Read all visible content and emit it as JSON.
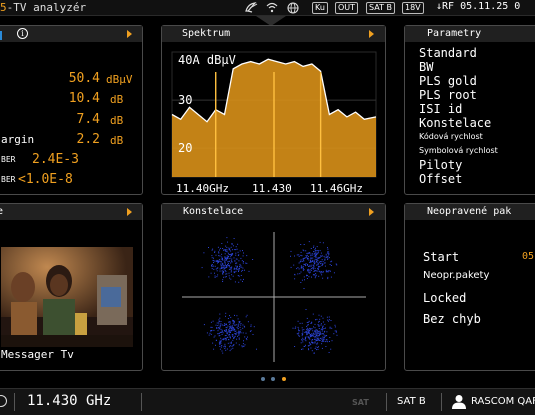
{
  "header": {
    "title_accent": "5",
    "title": "-TV analyzér",
    "badges": [
      "Ku",
      "OUT",
      "SAT B",
      "18V"
    ],
    "rf_label": "↓RF",
    "date": "05.11.25 0"
  },
  "left_panel": {
    "rows": [
      {
        "label": "",
        "value": "50.4",
        "unit": "dBµV"
      },
      {
        "label": "",
        "value": "10.4",
        "unit": "dB"
      },
      {
        "label": "",
        "value": "7.4",
        "unit": "dB"
      },
      {
        "label": "argin",
        "value": "2.2",
        "unit": "dB"
      },
      {
        "label": "BER",
        "value": "2.4E-3",
        "unit": ""
      },
      {
        "label": "BER",
        "value": "<1.0E-8",
        "unit": ""
      }
    ]
  },
  "spectrum": {
    "title": "Spektrum",
    "level": "40A dBµV",
    "y_labels": [
      "30",
      "20"
    ],
    "x_labels": [
      "11.40GHz",
      "11.430",
      "11.46GHz"
    ]
  },
  "chart_data": {
    "type": "area",
    "title": "Spektrum",
    "ylabel": "dBµV",
    "x_range": [
      11.395,
      11.465
    ],
    "ylim": [
      14,
      40
    ],
    "y_ticks": [
      20,
      30
    ],
    "x": [
      11.395,
      11.398,
      11.401,
      11.404,
      11.407,
      11.41,
      11.413,
      11.416,
      11.419,
      11.422,
      11.425,
      11.428,
      11.431,
      11.434,
      11.437,
      11.44,
      11.443,
      11.446,
      11.449,
      11.452,
      11.455,
      11.458,
      11.461,
      11.465
    ],
    "y": [
      27,
      26,
      28.5,
      27,
      25.5,
      28,
      27,
      36.5,
      37.5,
      38,
      37.5,
      38.5,
      38,
      37.5,
      38,
      37,
      37.5,
      36,
      27,
      28,
      26.5,
      27.5,
      26,
      26.5
    ],
    "markers": [
      11.41,
      11.43,
      11.446
    ]
  },
  "params": {
    "title": "Parametry",
    "items": [
      "Standard",
      "BW",
      "PLS gold",
      "PLS root",
      "ISI id",
      "Konstelace",
      "Kódová rychlost",
      "Symbolová rychlost",
      "Piloty",
      "Offset"
    ]
  },
  "video": {
    "title": "e",
    "caption": "Messager Tv"
  },
  "constellation": {
    "title": "Konstelace"
  },
  "packets": {
    "title": "Neopravené pak",
    "rows": [
      {
        "label": "Start",
        "value": "05"
      },
      {
        "label": "Neopr.pakety",
        "value": ""
      },
      {
        "label": "Locked",
        "value": ""
      },
      {
        "label": "Bez chyb",
        "value": ""
      }
    ]
  },
  "footer": {
    "frequency": "11.430 GHz",
    "sat_faded": "SAT",
    "sat": "SAT B",
    "operator": "RASCOM QAF"
  },
  "colors": {
    "accent": "#f0a020",
    "spectrum_fill": "#d89018",
    "constellation": "#2c44d8"
  }
}
